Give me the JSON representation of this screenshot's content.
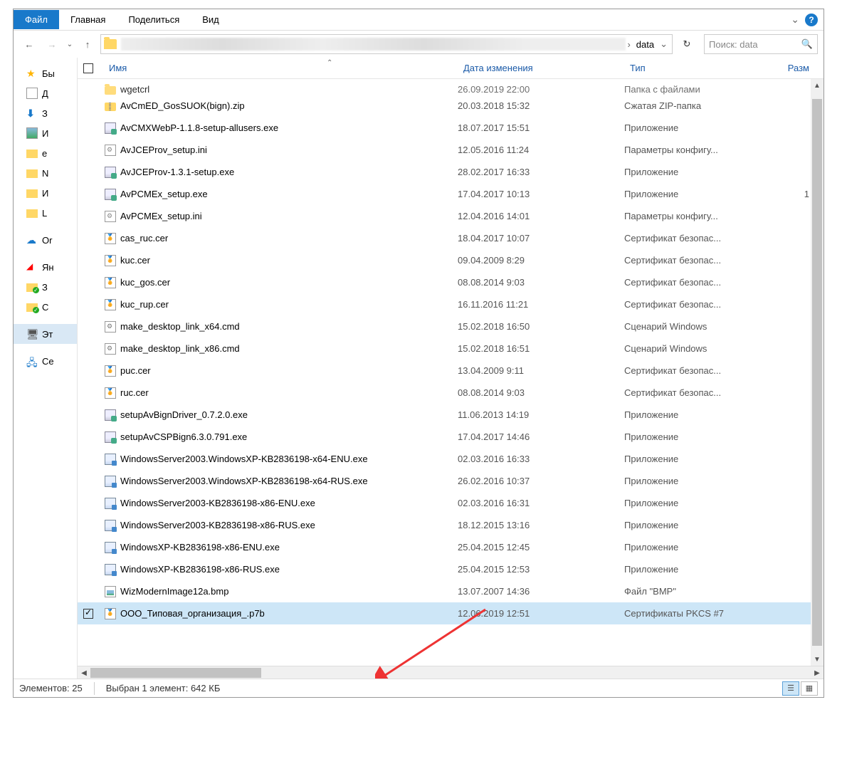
{
  "ribbon": {
    "tabs": [
      "Файл",
      "Главная",
      "Поделиться",
      "Вид"
    ]
  },
  "address": {
    "current_folder": "data",
    "search_placeholder": "Поиск: data"
  },
  "columns": {
    "name": "Имя",
    "date": "Дата изменения",
    "type": "Тип",
    "size": "Разм"
  },
  "sidebar": [
    {
      "label": "Бы",
      "icon": "star"
    },
    {
      "label": "Д",
      "icon": "doc"
    },
    {
      "label": "З",
      "icon": "down"
    },
    {
      "label": "И",
      "icon": "img"
    },
    {
      "label": "e",
      "icon": "fold"
    },
    {
      "label": "N",
      "icon": "fold"
    },
    {
      "label": "И",
      "icon": "fold"
    },
    {
      "label": "L",
      "icon": "fold"
    },
    {
      "gap": true
    },
    {
      "label": "Or",
      "icon": "cloud"
    },
    {
      "gap": true
    },
    {
      "label": "Ян",
      "icon": "ydisk"
    },
    {
      "label": "З",
      "icon": "fold",
      "sync": true
    },
    {
      "label": "С",
      "icon": "fold",
      "sync": true
    },
    {
      "gap": true
    },
    {
      "label": "Эт",
      "icon": "pc",
      "selected": true
    },
    {
      "gap": true
    },
    {
      "label": "Се",
      "icon": "net"
    }
  ],
  "files": [
    {
      "name": "wgetcrl",
      "date": "26.09.2019 22:00",
      "type": "Папка с файлами",
      "icon": "folder",
      "cutoff": true
    },
    {
      "name": "AvCmED_GosSUOK(bign).zip",
      "date": "20.03.2018 15:32",
      "type": "Сжатая ZIP-папка",
      "icon": "zip"
    },
    {
      "name": "AvCMXWebP-1.1.8-setup-allusers.exe",
      "date": "18.07.2017 15:51",
      "type": "Приложение",
      "icon": "exe"
    },
    {
      "name": "AvJCEProv_setup.ini",
      "date": "12.05.2016 11:24",
      "type": "Параметры конфигу...",
      "icon": "ini"
    },
    {
      "name": "AvJCEProv-1.3.1-setup.exe",
      "date": "28.02.2017 16:33",
      "type": "Приложение",
      "icon": "exe"
    },
    {
      "name": "AvPCMEx_setup.exe",
      "date": "17.04.2017 10:13",
      "type": "Приложение",
      "icon": "exe",
      "size": "1"
    },
    {
      "name": "AvPCMEx_setup.ini",
      "date": "12.04.2016 14:01",
      "type": "Параметры конфигу...",
      "icon": "ini"
    },
    {
      "name": "cas_ruc.cer",
      "date": "18.04.2017 10:07",
      "type": "Сертификат безопас...",
      "icon": "cer"
    },
    {
      "name": "kuc.cer",
      "date": "09.04.2009 8:29",
      "type": "Сертификат безопас...",
      "icon": "cer"
    },
    {
      "name": "kuc_gos.cer",
      "date": "08.08.2014 9:03",
      "type": "Сертификат безопас...",
      "icon": "cer"
    },
    {
      "name": "kuc_rup.cer",
      "date": "16.11.2016 11:21",
      "type": "Сертификат безопас...",
      "icon": "cer"
    },
    {
      "name": "make_desktop_link_x64.cmd",
      "date": "15.02.2018 16:50",
      "type": "Сценарий Windows",
      "icon": "cmd"
    },
    {
      "name": "make_desktop_link_x86.cmd",
      "date": "15.02.2018 16:51",
      "type": "Сценарий Windows",
      "icon": "cmd"
    },
    {
      "name": "puc.cer",
      "date": "13.04.2009 9:11",
      "type": "Сертификат безопас...",
      "icon": "cer"
    },
    {
      "name": "ruc.cer",
      "date": "08.08.2014 9:03",
      "type": "Сертификат безопас...",
      "icon": "cer"
    },
    {
      "name": "setupAvBignDriver_0.7.2.0.exe",
      "date": "11.06.2013 14:19",
      "type": "Приложение",
      "icon": "exe"
    },
    {
      "name": "setupAvCSPBign6.3.0.791.exe",
      "date": "17.04.2017 14:46",
      "type": "Приложение",
      "icon": "exe"
    },
    {
      "name": "WindowsServer2003.WindowsXP-KB2836198-x64-ENU.exe",
      "date": "02.03.2016 16:33",
      "type": "Приложение",
      "icon": "patch"
    },
    {
      "name": "WindowsServer2003.WindowsXP-KB2836198-x64-RUS.exe",
      "date": "26.02.2016 10:37",
      "type": "Приложение",
      "icon": "patch"
    },
    {
      "name": "WindowsServer2003-KB2836198-x86-ENU.exe",
      "date": "02.03.2016 16:31",
      "type": "Приложение",
      "icon": "patch"
    },
    {
      "name": "WindowsServer2003-KB2836198-x86-RUS.exe",
      "date": "18.12.2015 13:16",
      "type": "Приложение",
      "icon": "patch"
    },
    {
      "name": "WindowsXP-KB2836198-x86-ENU.exe",
      "date": "25.04.2015 12:45",
      "type": "Приложение",
      "icon": "patch"
    },
    {
      "name": "WindowsXP-KB2836198-x86-RUS.exe",
      "date": "25.04.2015 12:53",
      "type": "Приложение",
      "icon": "patch"
    },
    {
      "name": "WizModernImage12a.bmp",
      "date": "13.07.2007 14:36",
      "type": "Файл \"BMP\"",
      "icon": "bmp"
    },
    {
      "name": "ООО_Типовая_организация_.p7b",
      "date": "12.06.2019 12:51",
      "type": "Сертификаты PKCS #7",
      "icon": "p7b",
      "selected": true,
      "checked": true
    }
  ],
  "status": {
    "count_label": "Элементов: 25",
    "selection_label": "Выбран 1 элемент: 642 КБ"
  }
}
